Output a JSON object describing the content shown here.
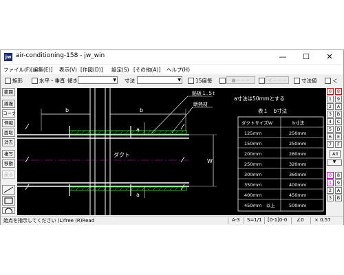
{
  "window": {
    "title": "air-conditioning-158 - jw_win",
    "icon_label": "jw",
    "min": "—",
    "max": "☐",
    "close": "✕"
  },
  "menu": [
    "ファイル(F)",
    "[編集(E)]",
    "表示(V)",
    "[作図(D)]",
    "設定(S)",
    "[その他(A)]",
    "ヘルプ(H)"
  ],
  "toolbar": {
    "rect_label": "矩形",
    "hv_label": "水平・垂直",
    "slope_label": "傾き",
    "dim_label": "寸法",
    "deg15_label": "15度毎",
    "btn1_label": "●－－－",
    "btn2_label": "＜－－－",
    "dimval_label": "寸法値",
    "lt_label": "＜"
  },
  "left_tools": [
    "範囲",
    "線複",
    "コーナー",
    "伸縮",
    "面取",
    "消去",
    "複写",
    "移動",
    "戻る"
  ],
  "right_tools": {
    "col1": [
      "0",
      "1",
      "2",
      "3",
      "4",
      "5",
      "6",
      "7",
      "8",
      "9",
      "A",
      "B"
    ],
    "col2": [
      "8",
      "9",
      "A",
      "B",
      "C",
      "D",
      "E",
      "F"
    ],
    "all_label": "All",
    "lower1": [
      "0",
      "1",
      "2",
      "3"
    ],
    "lower2": [
      "8",
      "9",
      "A",
      "B"
    ]
  },
  "drawing": {
    "note_title": "a寸法は50ｍｍとする",
    "table_title": "表１　b寸法",
    "table_headers": [
      "ダクトサイズW",
      "b寸法"
    ],
    "table_rows": [
      [
        "125ｍｍ",
        "250ｍｍ"
      ],
      [
        "150ｍｍ",
        "250ｍｍ"
      ],
      [
        "200ｍｍ",
        "280ｍｍ"
      ],
      [
        "250ｍｍ",
        "320ｍｍ"
      ],
      [
        "300ｍｍ",
        "360ｍｍ"
      ],
      [
        "350ｍｍ",
        "400ｍｍ"
      ],
      [
        "400ｍｍ",
        "450ｍｍ"
      ],
      [
        "450ｍｍ　以上",
        "500ｍｍ"
      ]
    ],
    "label_b": "b",
    "label_a": "a",
    "label_w": "W",
    "label_duct": "ダクト",
    "label_plate": "鉛板１.５t",
    "label_insul": "断熱材"
  },
  "status": {
    "message": "始点を指示してください (L)free (R)Read",
    "sheet": "A-3",
    "scale": "S=1/1",
    "layer": "[0-1]0-0",
    "angle": "∠0",
    "zoom": "× 0.57"
  }
}
